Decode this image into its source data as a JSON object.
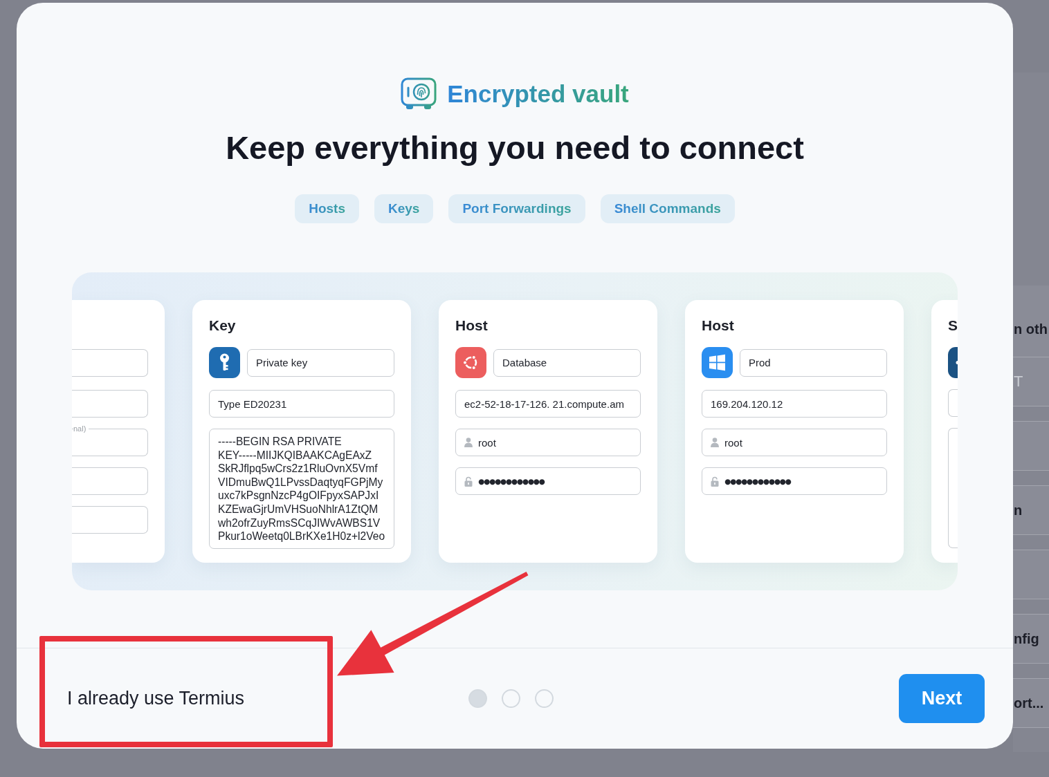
{
  "background_window": {
    "rows": [
      {
        "kind": "heading",
        "text": "n oth"
      },
      {
        "kind": "field",
        "text": "T"
      },
      {
        "kind": "blank"
      },
      {
        "kind": "item",
        "text": "n"
      },
      {
        "kind": "blank"
      },
      {
        "kind": "item",
        "text": "nfig"
      },
      {
        "kind": "item",
        "text": "ort..."
      }
    ]
  },
  "dialog": {
    "badge": {
      "title": "Encrypted vault"
    },
    "heading": "Keep everything you need to connect",
    "tags": [
      "Hosts",
      "Keys",
      "Port Forwardings",
      "Shell Commands"
    ],
    "carousel": {
      "cards": [
        {
          "kind": "cut_left",
          "fields": [
            {
              "kind": "input"
            },
            {
              "kind": "input"
            },
            {
              "kind": "input",
              "label": "nal)"
            },
            {
              "kind": "input"
            },
            {
              "kind": "input"
            }
          ]
        },
        {
          "kind": "key",
          "title": "Key",
          "tile": {
            "kind": "key",
            "color": "#1f6cb1"
          },
          "fields": [
            {
              "kind": "name",
              "value": "Private key"
            },
            {
              "kind": "input",
              "value": "Type ED20231"
            },
            {
              "kind": "textarea",
              "lines": [
                "-----BEGIN RSA PRIVATE",
                "KEY-----MIIJKQIBAAKCAgEAxZ",
                "SkRJflpq5wCrs2z1RluOvnX5Vmf",
                "VIDmuBwQ1LPvssDaqtyqFGPjMy",
                "uxc7kPsgnNzcP4gOIFpyxSAPJxI",
                "KZEwaGjrUmVHSuoNhlrA1ZtQM",
                "wh2ofrZuyRmsSCqJIWvAWBS1V",
                "Pkur1oWeetq0LBrKXe1H0z+l2Veo"
              ]
            }
          ]
        },
        {
          "kind": "host",
          "title": "Host",
          "tile": {
            "kind": "ring",
            "color": "#ec5e5e"
          },
          "fields": [
            {
              "kind": "name",
              "value": "Database"
            },
            {
              "kind": "input",
              "value": "ec2-52-18-17-126. 21.compute.am"
            },
            {
              "kind": "user",
              "value": "root"
            },
            {
              "kind": "password",
              "value": "●●●●●●●●●●●●"
            }
          ]
        },
        {
          "kind": "host",
          "title": "Host",
          "tile": {
            "kind": "panes",
            "color": "#2a8ef0"
          },
          "fields": [
            {
              "kind": "name",
              "value": "Prod"
            },
            {
              "kind": "input",
              "value": "169.204.120.12"
            },
            {
              "kind": "user",
              "value": "root"
            },
            {
              "kind": "password",
              "value": "●●●●●●●●●●●●"
            }
          ]
        },
        {
          "kind": "cut_right",
          "title": "S",
          "tile": {
            "kind": "partial",
            "color": "#1b5283"
          },
          "fields": [
            {
              "kind": "input"
            },
            {
              "kind": "textarea"
            }
          ]
        }
      ]
    },
    "footer": {
      "link": {
        "label": "I already use Termius",
        "highlighted": true
      },
      "pager": [
        {
          "selected": true
        },
        {
          "selected": false
        },
        {
          "selected": false
        }
      ],
      "next_button": "Next"
    }
  }
}
